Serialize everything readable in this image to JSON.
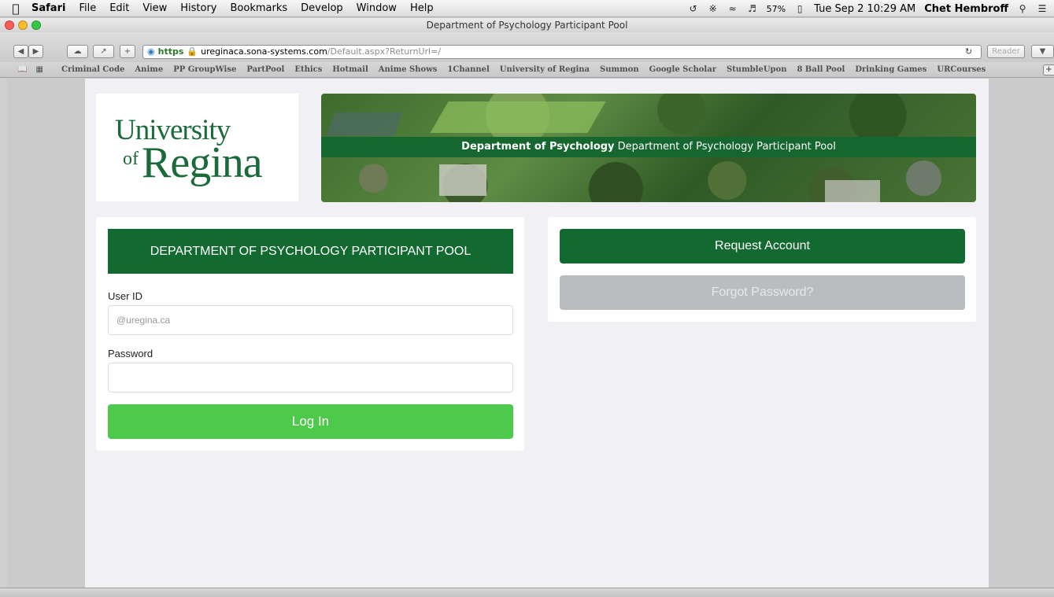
{
  "menubar": {
    "app": "Safari",
    "items": [
      "File",
      "Edit",
      "View",
      "History",
      "Bookmarks",
      "Develop",
      "Window",
      "Help"
    ],
    "battery": "57%",
    "clock": "Tue Sep 2  10:29 AM",
    "user": "Chet Hembroff"
  },
  "window": {
    "title": "Department of Psychology Participant Pool"
  },
  "toolbar": {
    "scheme": "https",
    "host": "ureginaca.sona-systems.com",
    "path": "/Default.aspx?ReturnUrl=/",
    "reader": "Reader"
  },
  "bookmarks": [
    "Criminal Code",
    "Anime",
    "PP GroupWise",
    "PartPool",
    "Ethics",
    "Hotmail",
    "Anime Shows",
    "1Channel",
    "University of Regina",
    "Summon",
    "Google Scholar",
    "StumbleUpon",
    "8 Ball Pool",
    "Drinking Games",
    "URCourses"
  ],
  "logo": {
    "line1": "University",
    "of": "of",
    "line2": "Regina"
  },
  "banner": {
    "bold": "Department of Psychology",
    "rest": " Department of Psychology Participant Pool"
  },
  "login": {
    "header": "DEPARTMENT OF PSYCHOLOGY PARTICIPANT POOL",
    "user_label": "User ID",
    "user_placeholder": "@uregina.ca",
    "password_label": "Password",
    "button": "Log In"
  },
  "side": {
    "request": "Request Account",
    "forgot": "Forgot Password?"
  },
  "colors": {
    "brand_green": "#136a30",
    "login_green": "#4fc94c",
    "disabled_gray": "#babdc0"
  }
}
